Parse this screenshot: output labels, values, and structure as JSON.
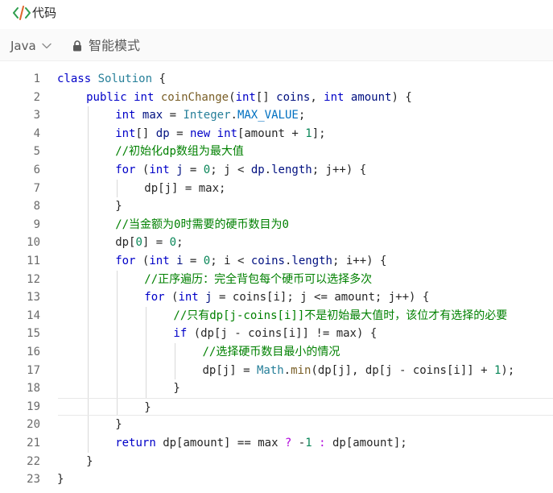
{
  "header": {
    "title": "代码",
    "icon": "code-icon",
    "icon_color": "#2e9e4d"
  },
  "toolbar": {
    "language": "Java",
    "mode": "智能模式",
    "language_icon": "chevron-down-icon",
    "mode_icon": "lock-icon"
  },
  "editor": {
    "current_line": 19,
    "lines": [
      {
        "num": "1",
        "indent": 0,
        "tokens": [
          {
            "t": "class ",
            "c": "kw"
          },
          {
            "t": "Solution ",
            "c": "ty"
          },
          {
            "t": "{",
            "c": ""
          }
        ]
      },
      {
        "num": "2",
        "indent": 1,
        "tokens": [
          {
            "t": "public ",
            "c": "kw"
          },
          {
            "t": "int ",
            "c": "kw"
          },
          {
            "t": "coinChange",
            "c": "fn"
          },
          {
            "t": "(",
            "c": ""
          },
          {
            "t": "int",
            "c": "kw"
          },
          {
            "t": "[] ",
            "c": ""
          },
          {
            "t": "coins",
            "c": "vr"
          },
          {
            "t": ", ",
            "c": ""
          },
          {
            "t": "int ",
            "c": "kw"
          },
          {
            "t": "amount",
            "c": "vr"
          },
          {
            "t": ") {",
            "c": ""
          }
        ]
      },
      {
        "num": "3",
        "indent": 2,
        "tokens": [
          {
            "t": "int ",
            "c": "kw"
          },
          {
            "t": "max",
            "c": "vr"
          },
          {
            "t": " = ",
            "c": ""
          },
          {
            "t": "Integer",
            "c": "ty"
          },
          {
            "t": ".",
            "c": ""
          },
          {
            "t": "MAX_VALUE",
            "c": "cn"
          },
          {
            "t": ";",
            "c": ""
          }
        ]
      },
      {
        "num": "4",
        "indent": 2,
        "tokens": [
          {
            "t": "int",
            "c": "kw"
          },
          {
            "t": "[] ",
            "c": ""
          },
          {
            "t": "dp",
            "c": "vr"
          },
          {
            "t": " = ",
            "c": ""
          },
          {
            "t": "new ",
            "c": "kw"
          },
          {
            "t": "int",
            "c": "kw"
          },
          {
            "t": "[amount + ",
            "c": ""
          },
          {
            "t": "1",
            "c": "nu"
          },
          {
            "t": "];",
            "c": ""
          }
        ]
      },
      {
        "num": "5",
        "indent": 2,
        "tokens": [
          {
            "t": "//初始化dp数组为最大值",
            "c": "cm"
          }
        ]
      },
      {
        "num": "6",
        "indent": 2,
        "tokens": [
          {
            "t": "for ",
            "c": "kw"
          },
          {
            "t": "(",
            "c": ""
          },
          {
            "t": "int ",
            "c": "kw"
          },
          {
            "t": "j",
            "c": "vr"
          },
          {
            "t": " = ",
            "c": ""
          },
          {
            "t": "0",
            "c": "nu"
          },
          {
            "t": "; j < ",
            "c": ""
          },
          {
            "t": "dp",
            "c": "vr"
          },
          {
            "t": ".",
            "c": ""
          },
          {
            "t": "length",
            "c": "vr"
          },
          {
            "t": "; j++) {",
            "c": ""
          }
        ]
      },
      {
        "num": "7",
        "indent": 3,
        "tokens": [
          {
            "t": "dp[j] = max;",
            "c": ""
          }
        ]
      },
      {
        "num": "8",
        "indent": 2,
        "tokens": [
          {
            "t": "}",
            "c": ""
          }
        ]
      },
      {
        "num": "9",
        "indent": 2,
        "tokens": [
          {
            "t": "//当金额为0时需要的硬币数目为0",
            "c": "cm"
          }
        ]
      },
      {
        "num": "10",
        "indent": 2,
        "tokens": [
          {
            "t": "dp[",
            "c": ""
          },
          {
            "t": "0",
            "c": "nu"
          },
          {
            "t": "] = ",
            "c": ""
          },
          {
            "t": "0",
            "c": "nu"
          },
          {
            "t": ";",
            "c": ""
          }
        ]
      },
      {
        "num": "11",
        "indent": 2,
        "tokens": [
          {
            "t": "for ",
            "c": "kw"
          },
          {
            "t": "(",
            "c": ""
          },
          {
            "t": "int ",
            "c": "kw"
          },
          {
            "t": "i",
            "c": "vr"
          },
          {
            "t": " = ",
            "c": ""
          },
          {
            "t": "0",
            "c": "nu"
          },
          {
            "t": "; i < ",
            "c": ""
          },
          {
            "t": "coins",
            "c": "vr"
          },
          {
            "t": ".",
            "c": ""
          },
          {
            "t": "length",
            "c": "vr"
          },
          {
            "t": "; i++) {",
            "c": ""
          }
        ]
      },
      {
        "num": "12",
        "indent": 3,
        "tokens": [
          {
            "t": "//正序遍历：完全背包每个硬币可以选择多次",
            "c": "cm"
          }
        ]
      },
      {
        "num": "13",
        "indent": 3,
        "tokens": [
          {
            "t": "for ",
            "c": "kw"
          },
          {
            "t": "(",
            "c": ""
          },
          {
            "t": "int ",
            "c": "kw"
          },
          {
            "t": "j",
            "c": "vr"
          },
          {
            "t": " = coins[i]; j <= amount; j++) {",
            "c": ""
          }
        ]
      },
      {
        "num": "14",
        "indent": 4,
        "tokens": [
          {
            "t": "//只有dp[j-coins[i]]不是初始最大值时，该位才有选择的必要",
            "c": "cm"
          }
        ]
      },
      {
        "num": "15",
        "indent": 4,
        "tokens": [
          {
            "t": "if ",
            "c": "kw"
          },
          {
            "t": "(dp[j - coins[i]] != max) {",
            "c": ""
          }
        ]
      },
      {
        "num": "16",
        "indent": 5,
        "tokens": [
          {
            "t": "//选择硬币数目最小的情况",
            "c": "cm"
          }
        ]
      },
      {
        "num": "17",
        "indent": 5,
        "tokens": [
          {
            "t": "dp[j] = ",
            "c": ""
          },
          {
            "t": "Math",
            "c": "ty"
          },
          {
            "t": ".",
            "c": ""
          },
          {
            "t": "min",
            "c": "fn"
          },
          {
            "t": "(dp[j], dp[j - coins[i]] + ",
            "c": ""
          },
          {
            "t": "1",
            "c": "nu"
          },
          {
            "t": ");",
            "c": ""
          }
        ]
      },
      {
        "num": "18",
        "indent": 4,
        "tokens": [
          {
            "t": "}",
            "c": ""
          }
        ]
      },
      {
        "num": "19",
        "indent": 3,
        "tokens": [
          {
            "t": "}",
            "c": ""
          }
        ]
      },
      {
        "num": "20",
        "indent": 2,
        "tokens": [
          {
            "t": "}",
            "c": ""
          }
        ]
      },
      {
        "num": "21",
        "indent": 2,
        "tokens": [
          {
            "t": "return ",
            "c": "kw"
          },
          {
            "t": "dp[amount] == max ",
            "c": ""
          },
          {
            "t": "? ",
            "c": "op"
          },
          {
            "t": "-",
            "c": ""
          },
          {
            "t": "1",
            "c": "nu"
          },
          {
            "t": " ",
            "c": ""
          },
          {
            "t": ":",
            "c": "op"
          },
          {
            "t": " dp[amount];",
            "c": ""
          }
        ]
      },
      {
        "num": "22",
        "indent": 1,
        "tokens": [
          {
            "t": "}",
            "c": ""
          }
        ]
      },
      {
        "num": "23",
        "indent": 0,
        "tokens": [
          {
            "t": "}",
            "c": ""
          }
        ]
      }
    ]
  }
}
